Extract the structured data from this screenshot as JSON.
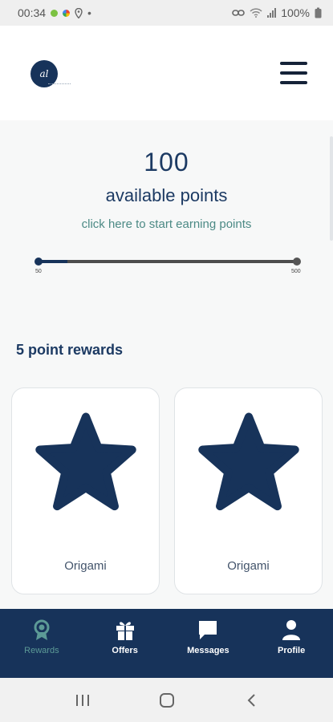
{
  "status_bar": {
    "time": "00:34",
    "battery": "100%",
    "dot_colors": [
      "#7cc242",
      "#f2a93b"
    ]
  },
  "header": {
    "logo_text": "al",
    "menu_icon": "hamburger-icon"
  },
  "points": {
    "value": "100",
    "label": "available points",
    "earn_link": "click here to start earning points",
    "progress": {
      "min_label": "50",
      "max_label": "500",
      "current": 100,
      "min": 50,
      "max": 500
    }
  },
  "rewards_section": {
    "title": "5 point rewards",
    "cards": [
      {
        "label": "Origami",
        "icon": "star-icon"
      },
      {
        "label": "Origami",
        "icon": "star-icon"
      }
    ]
  },
  "bottom_nav": {
    "items": [
      {
        "label": "Rewards",
        "icon": "award-ribbon-icon",
        "active": true
      },
      {
        "label": "Offers",
        "icon": "gift-icon",
        "active": false
      },
      {
        "label": "Messages",
        "icon": "chat-bubble-icon",
        "active": false
      },
      {
        "label": "Profile",
        "icon": "user-icon",
        "active": false
      }
    ]
  },
  "colors": {
    "brand": "#17335a",
    "accent": "#5c9a96",
    "link": "#4c8a85"
  }
}
